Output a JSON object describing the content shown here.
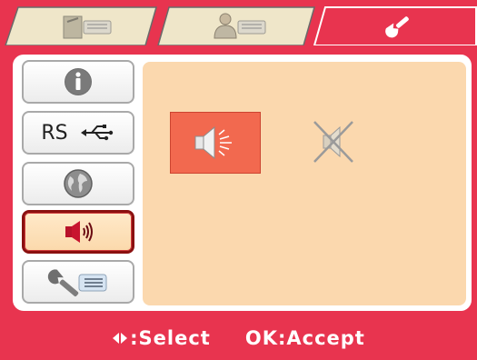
{
  "sidebar": {
    "items": [
      {
        "name": "info",
        "icon": "info-icon"
      },
      {
        "name": "rs-usb",
        "label": "RS",
        "icon": "usb-icon"
      },
      {
        "name": "network",
        "icon": "globe-icon"
      },
      {
        "name": "sound",
        "icon": "speaker-icon",
        "active": true
      },
      {
        "name": "tools",
        "icon": "wrench-list-icon"
      }
    ]
  },
  "tabs": [
    {
      "name": "device",
      "icon": "device-list-icon"
    },
    {
      "name": "user",
      "icon": "user-list-icon"
    },
    {
      "name": "settings",
      "icon": "wrench-icon",
      "active": true
    }
  ],
  "content": {
    "options": [
      {
        "name": "sound-on",
        "icon": "speaker-on-icon",
        "selected": true
      },
      {
        "name": "sound-off",
        "icon": "speaker-muted-icon",
        "selected": false
      }
    ]
  },
  "footer": {
    "select_hint": ":Select",
    "accept_hint": "OK:Accept"
  },
  "colors": {
    "frame": "#e8344f",
    "content_bg": "#fbd8ae",
    "selected_option": "#f2694f",
    "active_border": "#8a1010"
  }
}
